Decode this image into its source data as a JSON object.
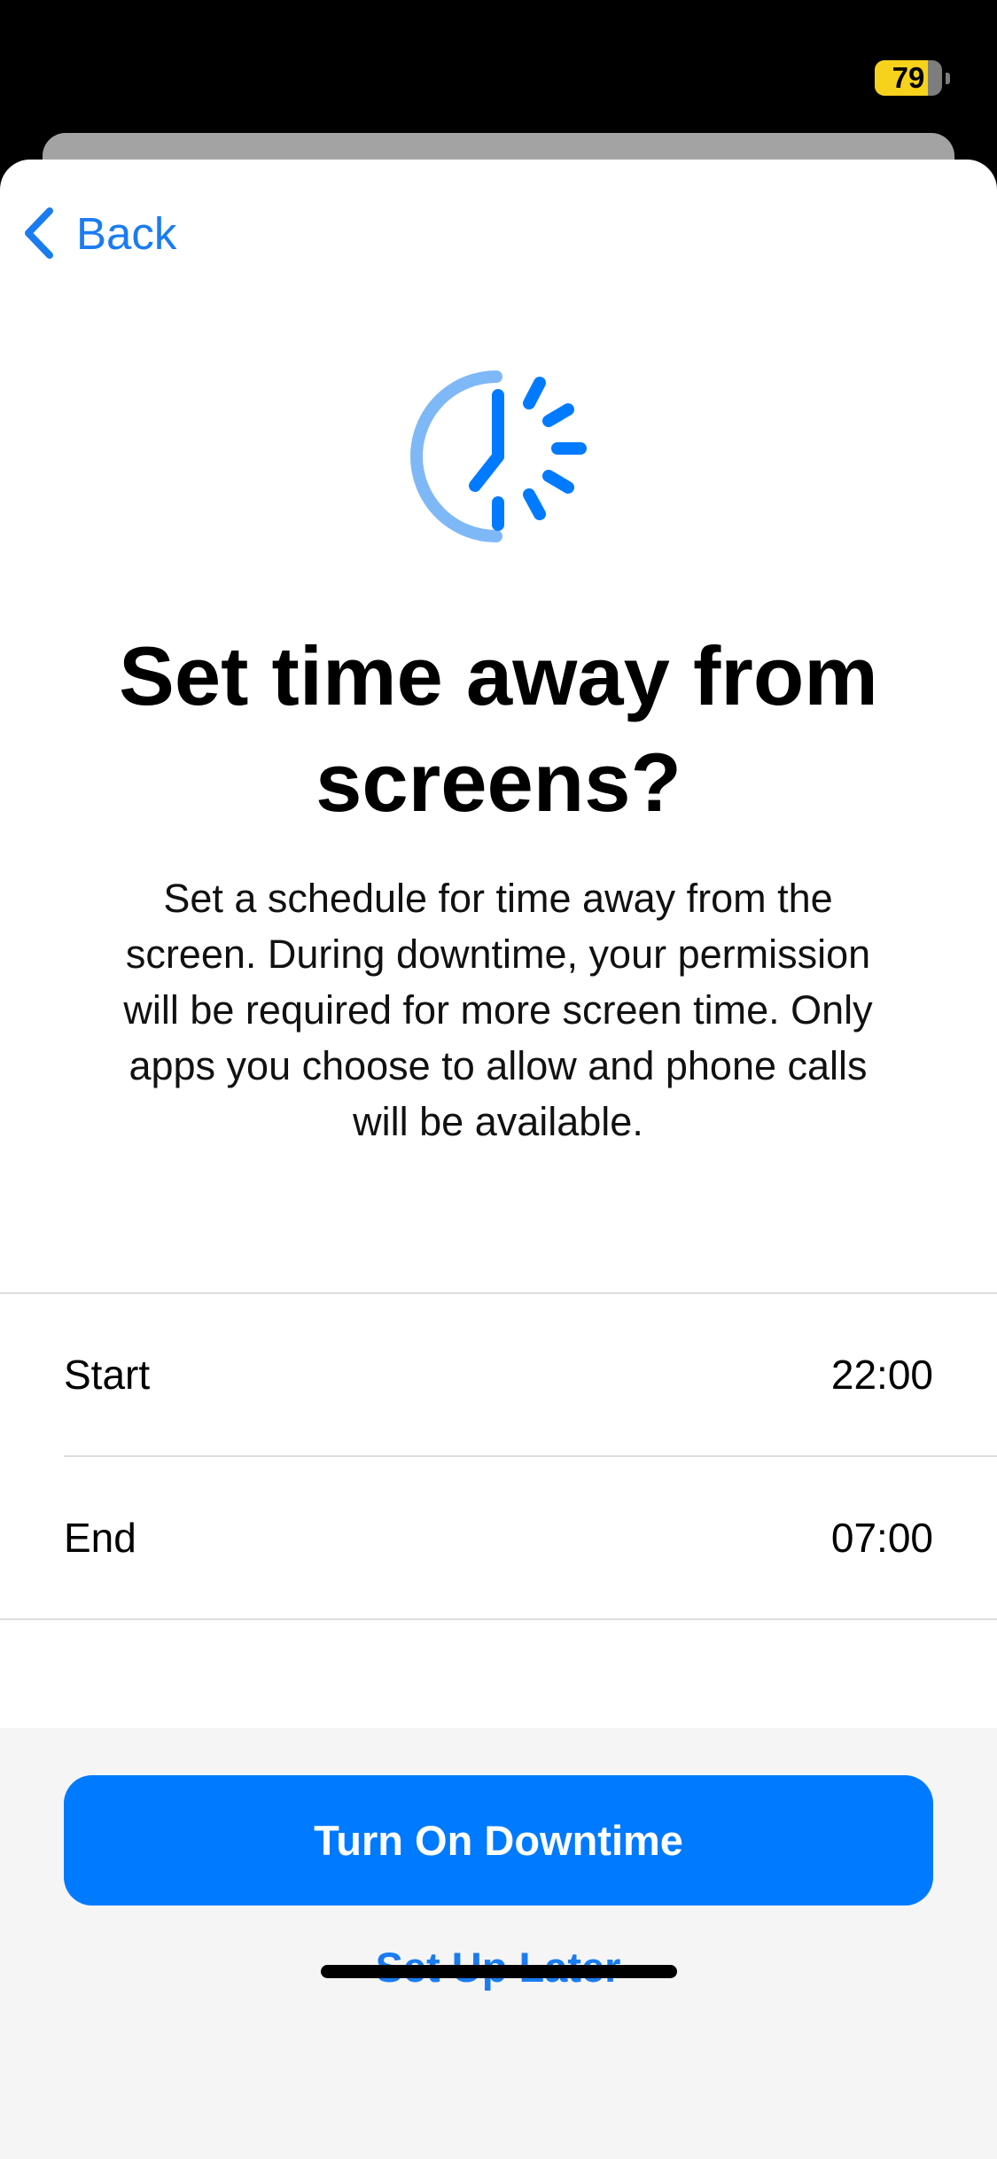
{
  "status_bar": {
    "battery_level": "79",
    "battery_fill_fraction": 0.79,
    "battery_color": "#f7d21c"
  },
  "nav": {
    "back_label": "Back",
    "back_icon": "chevron-left-icon"
  },
  "hero": {
    "icon": "downtime-clock-icon",
    "title": "Set time away from screens?",
    "description": "Set a schedule for time away from the screen. During downtime, your permission will be required for more screen time. Only apps you choose to allow and phone calls will be available."
  },
  "schedule": {
    "start": {
      "label": "Start",
      "value": "22:00"
    },
    "end": {
      "label": "End",
      "value": "07:00"
    }
  },
  "actions": {
    "primary_label": "Turn On Downtime",
    "secondary_label": "Set Up Later"
  },
  "colors": {
    "accent": "#007aff",
    "link": "#1a7cf0",
    "icon_light": "#7fb8f7",
    "footer_bg": "#f5f5f5"
  }
}
